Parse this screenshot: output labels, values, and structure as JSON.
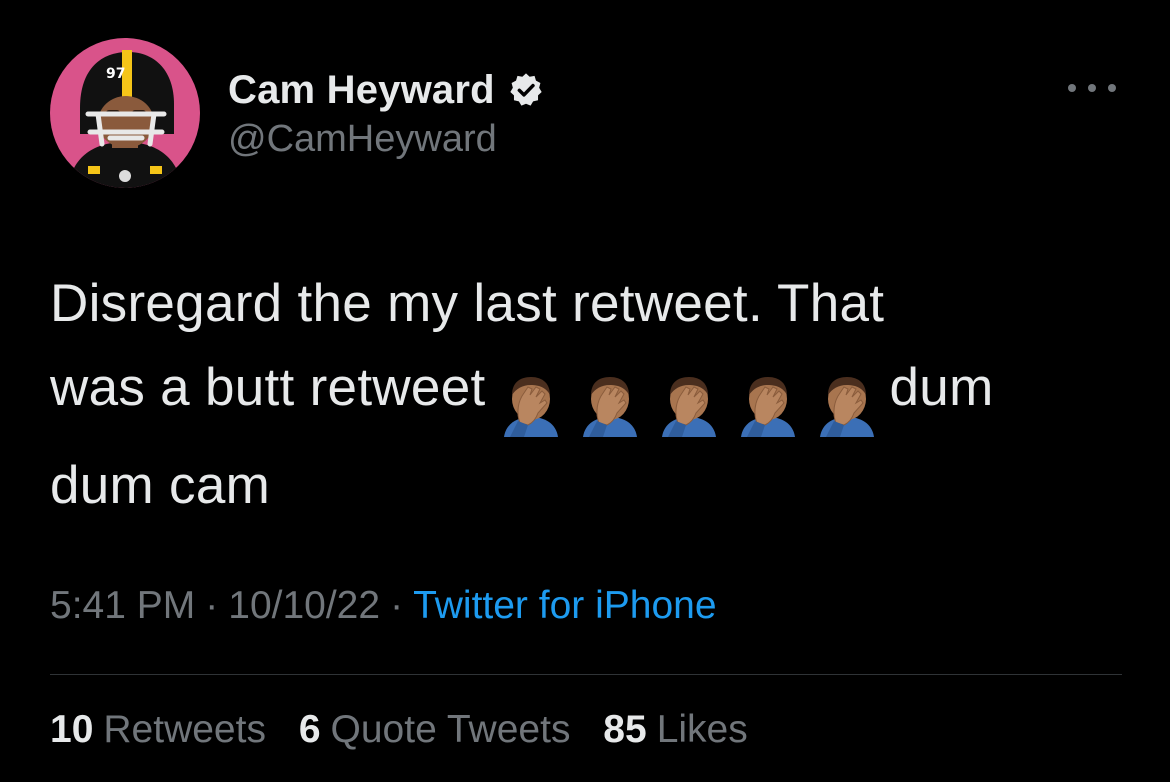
{
  "author": {
    "display_name": "Cam Heyward",
    "handle": "@CamHeyward",
    "verified_icon": "verified-badge-icon",
    "avatar_icon": "steelers-player-memoji-avatar",
    "avatar_bg": "#d9538a",
    "helmet_number": "97"
  },
  "tweet": {
    "line1": "Disregard the my last retweet. That",
    "line2_start": "was a butt retweet",
    "emoji": [
      "🤦🏽‍♂️",
      "🤦🏽‍♂️",
      "🤦🏽‍♂️",
      "🤦🏽‍♂️",
      "🤦🏽‍♂️"
    ],
    "line2_end": "dum",
    "line3": "dum cam"
  },
  "meta": {
    "time": "5:41 PM",
    "date": "10/10/22",
    "separator": "·",
    "source": "Twitter for iPhone"
  },
  "stats": {
    "retweets_count": "10",
    "retweets_label": "Retweets",
    "quotes_count": "6",
    "quotes_label": "Quote Tweets",
    "likes_count": "85",
    "likes_label": "Likes"
  },
  "colors": {
    "background": "#000000",
    "text": "#e7e9ea",
    "muted": "#71767b",
    "link": "#1d9bf0",
    "divider": "#2f3336"
  }
}
